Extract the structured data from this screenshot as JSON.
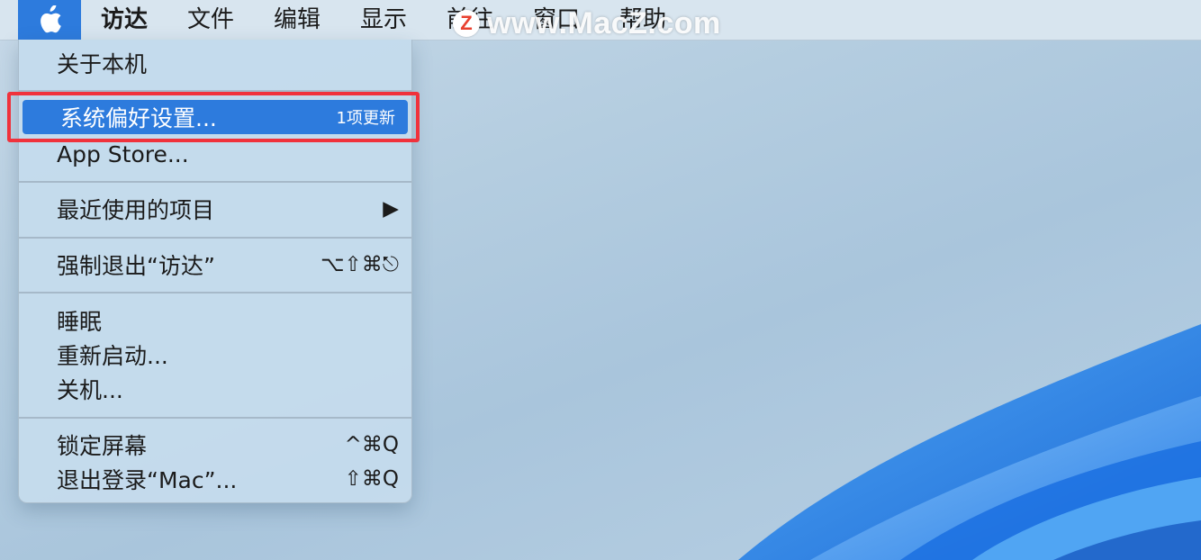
{
  "menubar": {
    "apple_icon": "apple-logo-icon",
    "items": [
      "访达",
      "文件",
      "编辑",
      "显示",
      "前往",
      "窗口",
      "帮助"
    ]
  },
  "watermark": {
    "logo": "Z",
    "text": "www.MacZ.com"
  },
  "apple_menu": {
    "about": "关于本机",
    "system_prefs": {
      "label": "系统偏好设置...",
      "badge": "1项更新"
    },
    "app_store": "App Store...",
    "recent_items": {
      "label": "最近使用的项目",
      "arrow": "▶"
    },
    "force_quit": {
      "label": "强制退出“访达”",
      "shortcut": "⌥⇧⌘⎋"
    },
    "sleep": "睡眠",
    "restart": "重新启动...",
    "shutdown": "关机...",
    "lock_screen": {
      "label": "锁定屏幕",
      "shortcut": "^⌘Q"
    },
    "logout": {
      "label": "退出登录“Mac”...",
      "shortcut": "⇧⌘Q"
    }
  },
  "colors": {
    "highlight": "#2d7bdd",
    "annotation": "#f0323c",
    "menu_bg": "#c4dbec"
  }
}
